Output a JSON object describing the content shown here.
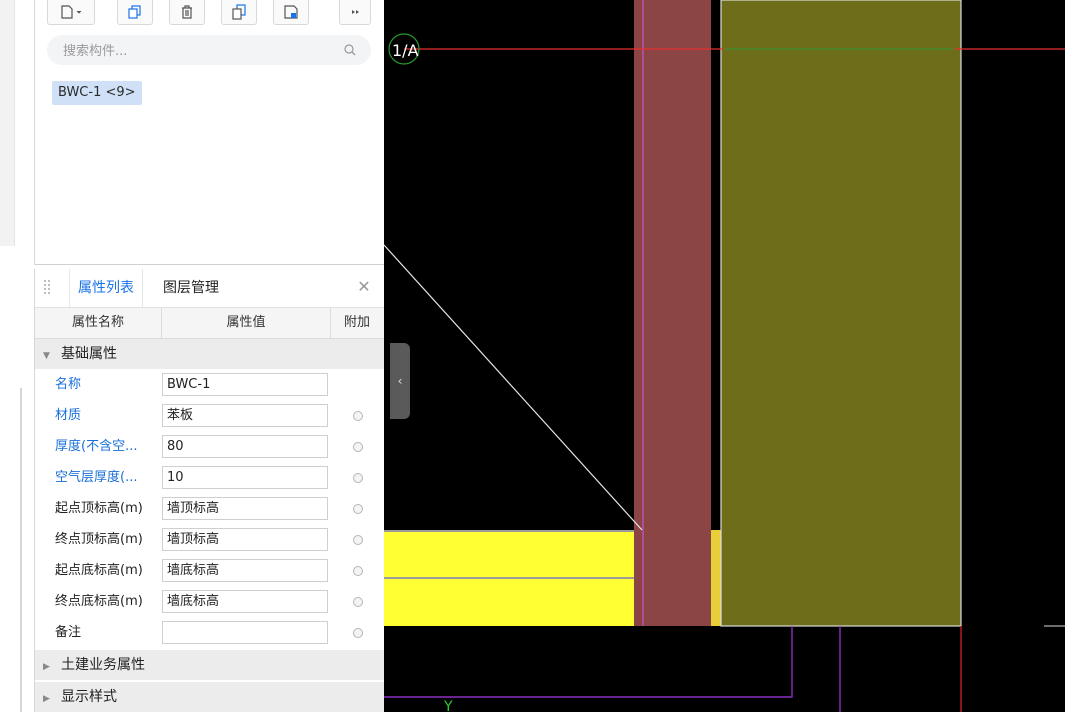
{
  "search": {
    "placeholder": "搜索构件..."
  },
  "component_chip": "BWC-1 <9>",
  "prop_panel": {
    "tabs": [
      {
        "label": "属性列表"
      },
      {
        "label": "图层管理"
      }
    ],
    "columns": {
      "name": "属性名称",
      "value": "属性值",
      "extra": "附加"
    },
    "groups": {
      "basic": "基础属性",
      "civil": "土建业务属性",
      "display": "显示样式"
    },
    "rows": [
      {
        "name": "名称",
        "value": "BWC-1"
      },
      {
        "name": "材质",
        "value": "苯板"
      },
      {
        "name": "厚度(不含空...",
        "value": "80"
      },
      {
        "name": "空气层厚度(...",
        "value": "10"
      },
      {
        "name": "起点顶标高(m)",
        "value": "墙顶标高"
      },
      {
        "name": "终点顶标高(m)",
        "value": "墙顶标高"
      },
      {
        "name": "起点底标高(m)",
        "value": "墙底标高"
      },
      {
        "name": "终点底标高(m)",
        "value": "墙底标高"
      },
      {
        "name": "备注",
        "value": ""
      }
    ]
  },
  "canvas": {
    "axis_label": "1/A",
    "y_label": "Y",
    "colors": {
      "background": "#000000",
      "wall": "#8b4545",
      "insulation": "#6e6e1a",
      "fill": "#ffff33",
      "axis": "#e53030"
    }
  }
}
